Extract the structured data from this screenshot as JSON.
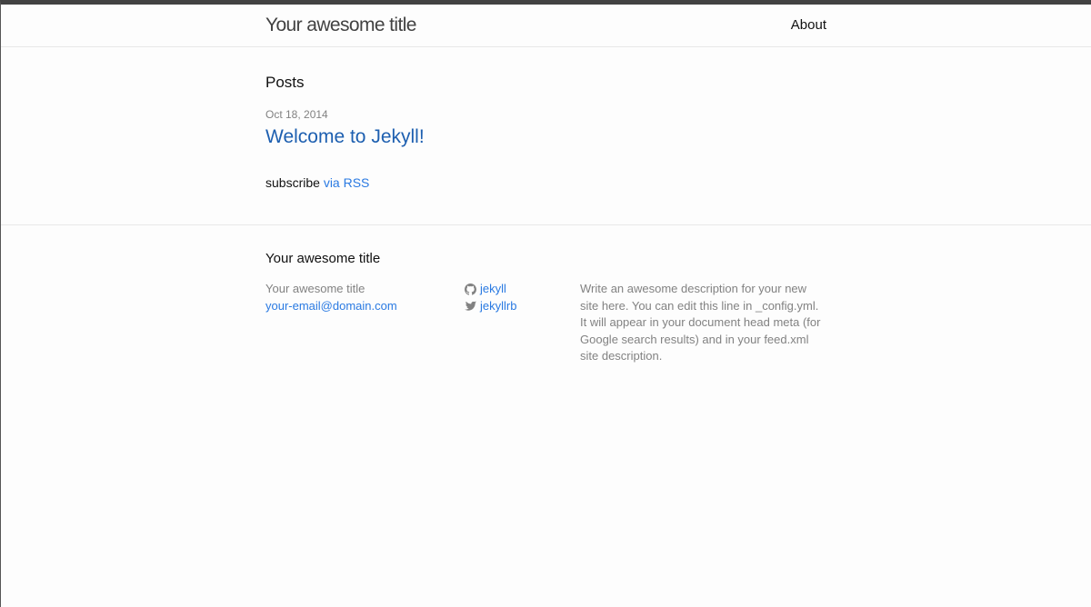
{
  "header": {
    "site_title": "Your awesome title",
    "nav": [
      {
        "label": "About"
      }
    ]
  },
  "main": {
    "heading": "Posts",
    "posts": [
      {
        "date": "Oct 18, 2014",
        "title": "Welcome to Jekyll!"
      }
    ],
    "rss_prefix": "subscribe",
    "rss_link": "via RSS"
  },
  "footer": {
    "heading": "Your awesome title",
    "name": "Your awesome title",
    "email": "your-email@domain.com",
    "social": [
      {
        "icon": "github-icon",
        "label": "jekyll"
      },
      {
        "icon": "twitter-icon",
        "label": "jekyllrb"
      }
    ],
    "description": "Write an awesome description for your new site here. You can edit this line in _config.yml. It will appear in your document head meta (for Google search results) and in your feed.xml site description."
  },
  "colors": {
    "link": "#2a7ae2",
    "meta_text": "#828282",
    "header_border": "#424242"
  }
}
